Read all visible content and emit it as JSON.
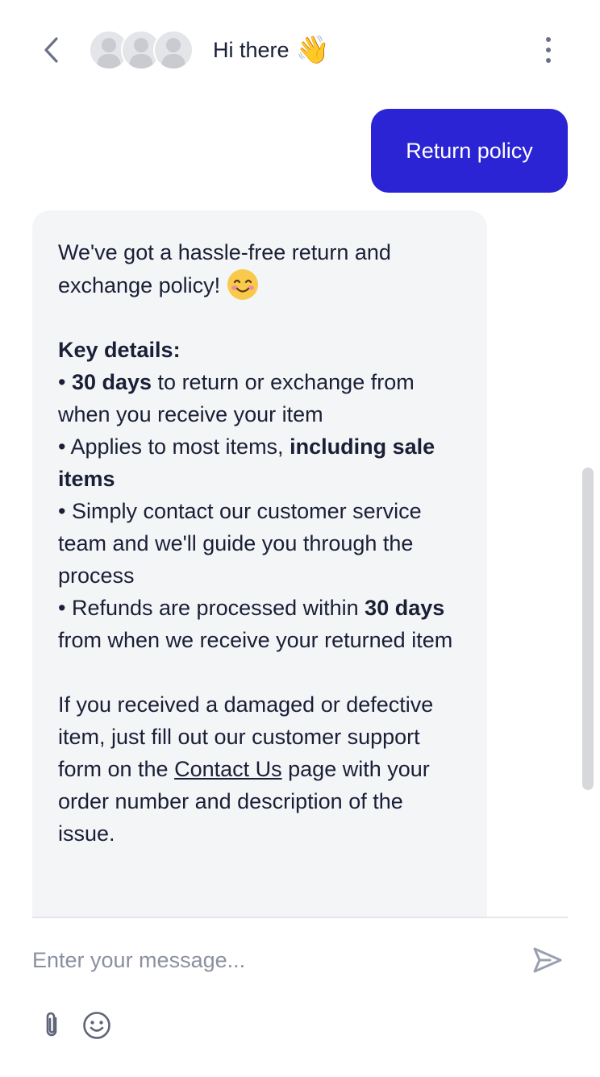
{
  "header": {
    "title": "Hi there",
    "title_emoji": "👋",
    "back_icon": "chevron-left-icon",
    "menu_icon": "more-vertical-icon",
    "avatar_count": 3
  },
  "messages": {
    "user": {
      "text": "Return policy"
    },
    "bot": {
      "intro_1": "We've got a hassle-free return and exchange policy!",
      "intro_emoji": "smiling-face-icon",
      "key_details_heading": "Key details:",
      "bullet_1_bold": "30 days",
      "bullet_1_rest": " to return or exchange from when you receive your item",
      "bullet_2_start": "Applies to most items, ",
      "bullet_2_bold": "including sale items",
      "bullet_3": "Simply contact our customer service team and we'll guide you through the process",
      "bullet_4_start": "Refunds are processed within ",
      "bullet_4_bold": "30 days",
      "bullet_4_rest": " from when we receive your returned item",
      "damaged_start": "If you received a damaged or defective item, just fill out our customer support form on the ",
      "damaged_link": "Contact Us",
      "damaged_end": " page with your order number and description of the issue."
    }
  },
  "composer": {
    "placeholder": "Enter your message...",
    "send_icon": "send-icon",
    "attach_icon": "paperclip-icon",
    "emoji_icon": "emoji-icon"
  },
  "colors": {
    "user_bubble": "#2a24d4",
    "bot_bubble": "#f4f5f7",
    "text": "#1a1f36",
    "placeholder": "#8b90a0"
  }
}
